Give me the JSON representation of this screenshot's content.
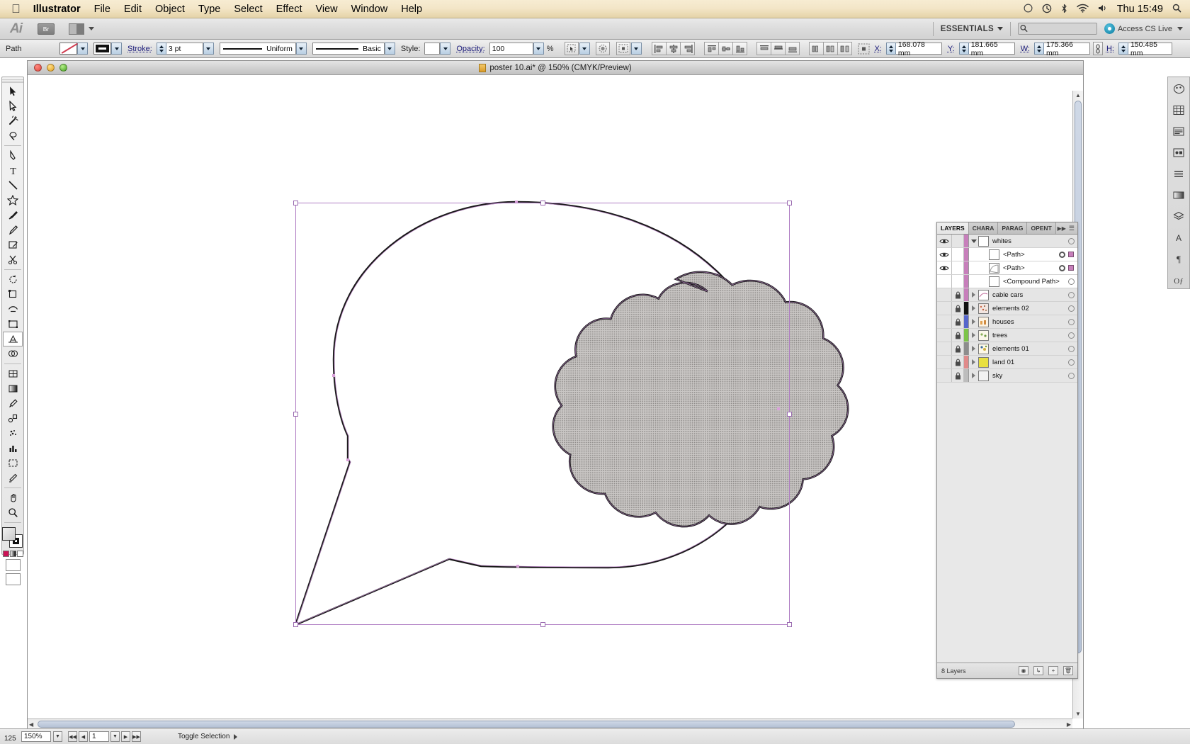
{
  "menubar": {
    "app_name": "Illustrator",
    "items": [
      "File",
      "Edit",
      "Object",
      "Type",
      "Select",
      "Effect",
      "View",
      "Window",
      "Help"
    ],
    "status_icons": [
      "circle-icon",
      "timemachine-icon",
      "bluetooth-icon",
      "wifi-icon",
      "volume-icon"
    ],
    "clock": "Thu 15:49",
    "spotlight_icon": "search-icon"
  },
  "appbar": {
    "logo": "Ai",
    "bridge_label": "Br",
    "arrange_label": "arrange-documents-icon",
    "workspace": "ESSENTIALS",
    "search_placeholder": "",
    "search_value": "",
    "cs_live_label": "Access CS Live"
  },
  "controlbar": {
    "object_type": "Path",
    "stroke_label": "Stroke:",
    "stroke_weight": "3 pt",
    "profile_label": "Uniform",
    "brush_label": "Basic",
    "style_label": "Style:",
    "style_value": "",
    "opacity_label": "Opacity:",
    "opacity_value": "100",
    "opacity_unit": "%",
    "x_label": "X:",
    "x_value": "168.078 mm",
    "y_label": "Y:",
    "y_value": "181.665 mm",
    "w_label": "W:",
    "w_value": "175.366 mm",
    "h_label": "H:",
    "h_value": "150.485 mm",
    "link_icon": "chain-link-icon",
    "transform_icon": "transform-reference-icon",
    "select_similar_icon": "select-similar-icon",
    "isolate_icon": "isolate-group-icon"
  },
  "document": {
    "title": "poster 10.ai* @ 150% (CMYK/Preview)",
    "traffic_lights": [
      "close-button",
      "minimize-button",
      "zoom-button"
    ]
  },
  "toolbar": {
    "tools": [
      {
        "name": "selection-tool",
        "selected": false
      },
      {
        "name": "direct-selection-tool",
        "selected": false
      },
      {
        "name": "magic-wand-tool",
        "selected": false
      },
      {
        "name": "lasso-tool",
        "selected": false
      },
      {
        "name": "pen-tool",
        "selected": false
      },
      {
        "name": "type-tool",
        "selected": false
      },
      {
        "name": "line-segment-tool",
        "selected": false
      },
      {
        "name": "shape-tool",
        "selected": false
      },
      {
        "name": "paintbrush-tool",
        "selected": false
      },
      {
        "name": "pencil-tool",
        "selected": false
      },
      {
        "name": "blob-brush-tool",
        "selected": false
      },
      {
        "name": "eraser-scissors-tool",
        "selected": false
      },
      {
        "name": "rotate-tool",
        "selected": false
      },
      {
        "name": "scale-tool",
        "selected": false
      },
      {
        "name": "width-warp-tool",
        "selected": false
      },
      {
        "name": "free-transform-tool",
        "selected": false
      },
      {
        "name": "shape-builder-tool",
        "selected": false
      },
      {
        "name": "perspective-grid-tool",
        "selected": true
      },
      {
        "name": "mesh-tool",
        "selected": false
      },
      {
        "name": "gradient-tool",
        "selected": false
      },
      {
        "name": "eyedropper-tool",
        "selected": false
      },
      {
        "name": "blend-tool",
        "selected": false
      },
      {
        "name": "symbol-sprayer-tool",
        "selected": false
      },
      {
        "name": "column-graph-tool",
        "selected": false
      },
      {
        "name": "artboard-tool",
        "selected": false
      },
      {
        "name": "slice-tool",
        "selected": false
      },
      {
        "name": "hand-tool",
        "selected": false
      },
      {
        "name": "zoom-tool",
        "selected": false
      }
    ]
  },
  "layers_panel": {
    "tabs": [
      {
        "label": "LAYERS",
        "active": true
      },
      {
        "label": "CHARA",
        "active": false
      },
      {
        "label": "PARAG",
        "active": false
      },
      {
        "label": "OPENT",
        "active": false
      }
    ],
    "collapse_icon": "collapse-panel-icon",
    "menu_icon": "panel-menu-icon",
    "rows": [
      {
        "name": "whites",
        "indent": 0,
        "visible": true,
        "locked": false,
        "color": "#c77fbb",
        "expanded": true,
        "kind": "layer",
        "selected": false,
        "thumb": "layer-thumb-blank"
      },
      {
        "name": "<Path>",
        "indent": 1,
        "visible": true,
        "locked": false,
        "color": "#c77fbb",
        "expanded": false,
        "kind": "object",
        "selected": true,
        "thumb": "path-thumb-blank"
      },
      {
        "name": "<Path>",
        "indent": 1,
        "visible": true,
        "locked": false,
        "color": "#c77fbb",
        "expanded": false,
        "kind": "object",
        "selected": true,
        "thumb": "path-thumb-curve"
      },
      {
        "name": "<Compound Path>",
        "indent": 1,
        "visible": false,
        "locked": false,
        "color": "#c77fbb",
        "expanded": false,
        "kind": "object",
        "selected": false,
        "thumb": "path-thumb-blank"
      },
      {
        "name": "cable cars",
        "indent": 0,
        "visible": false,
        "locked": true,
        "color": "#c77fbb",
        "expanded": false,
        "kind": "layer",
        "selected": false,
        "thumb": "layer-thumb-line"
      },
      {
        "name": "elements 02",
        "indent": 0,
        "visible": false,
        "locked": true,
        "color": "#111111",
        "expanded": false,
        "kind": "layer",
        "selected": false,
        "thumb": "layer-thumb-confetti"
      },
      {
        "name": "houses",
        "indent": 0,
        "visible": false,
        "locked": true,
        "color": "#5566cc",
        "expanded": false,
        "kind": "layer",
        "selected": false,
        "thumb": "layer-thumb-houses"
      },
      {
        "name": "trees",
        "indent": 0,
        "visible": false,
        "locked": true,
        "color": "#7cc44a",
        "expanded": false,
        "kind": "layer",
        "selected": false,
        "thumb": "layer-thumb-trees"
      },
      {
        "name": "elements 01",
        "indent": 0,
        "visible": false,
        "locked": true,
        "color": "#8d8d8d",
        "expanded": false,
        "kind": "layer",
        "selected": false,
        "thumb": "layer-thumb-elements"
      },
      {
        "name": "land 01",
        "indent": 0,
        "visible": false,
        "locked": true,
        "color": "#e08a8a",
        "expanded": false,
        "kind": "layer",
        "selected": false,
        "thumb": "layer-thumb-land"
      },
      {
        "name": "sky",
        "indent": 0,
        "visible": false,
        "locked": true,
        "color": "#bdbdbd",
        "expanded": false,
        "kind": "layer",
        "selected": false,
        "thumb": "layer-thumb-sky"
      }
    ],
    "footer_count": "8 Layers",
    "footer_buttons": [
      "make-clipping-mask-icon",
      "create-sublayer-icon",
      "create-new-layer-icon",
      "delete-layer-icon"
    ]
  },
  "right_dock": {
    "icons": [
      "color-panel-icon",
      "swatches-panel-icon",
      "brushes-panel-icon",
      "symbols-panel-icon",
      "stroke-panel-icon",
      "gradient-panel-icon",
      "layers-panel-icon",
      "appearance-panel-icon",
      "paragraph-panel-icon",
      "opentype-panel-icon"
    ]
  },
  "statusbar": {
    "left_number": "125",
    "zoom_value": "150%",
    "page_value": "1",
    "status_text": "Toggle Selection"
  },
  "artwork": {
    "description": "speech bubble with cloud shape, selected path",
    "selection_color": "#b07fc4",
    "stroke_color": "#1a1a1a",
    "cloud_fill": "#b3b0ae"
  }
}
